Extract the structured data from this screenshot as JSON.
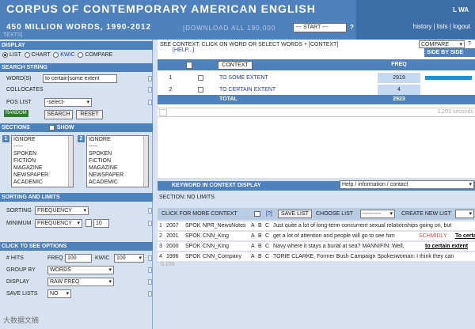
{
  "header": {
    "title": "CORPUS OF CONTEMPORARY AMERICAN ENGLISH",
    "subtitle": "450 MILLION WORDS, 1990-2012",
    "download": "[DOWNLOAD ALL 190,000",
    "texts": "TEXTS]",
    "start_select": "--- START ---",
    "help_mark": "?",
    "user": "L WA",
    "links": [
      "history",
      "lists",
      "logout"
    ]
  },
  "left": {
    "display_head": "DISPLAY",
    "display_opts": [
      "LIST",
      "CHART",
      "KWIC",
      "COMPARE"
    ],
    "search_head": "SEARCH STRING",
    "words_label": "WORD(S)",
    "words_value": "to certain|some extent",
    "collocates_label": "COLLOCATES",
    "poslist_label": "POS LIST",
    "poslist_value": "-select-",
    "random_label": "RANDOM",
    "search_btn": "SEARCH",
    "reset_btn": "RESET",
    "sections_head": "SECTIONS",
    "show_label": "SHOW",
    "section1_no": "1",
    "section2_no": "2",
    "sections1": [
      "IGNORE",
      "-----",
      "SPOKEN",
      "FICTION",
      "MAGAZINE",
      "NEWSPAPER",
      "ACADEMIC"
    ],
    "sections2": [
      "IGNORE",
      "-----",
      "SPOKEN",
      "FICTION",
      "MAGAZINE",
      "NEWSPAPER",
      "ACADEMIC"
    ],
    "sorting_head": "SORTING AND LIMITS",
    "sorting_label": "SORTING",
    "sorting_value": "FREQUENCY",
    "minimum_label": "MINIMUM",
    "minimum_value": "FREQUENCY",
    "minimum_num": "10",
    "options_head": "CLICK TO SEE OPTIONS",
    "hits_label": "# HITS",
    "freq_label": "FREQ",
    "freq_value": "100",
    "kwic_label": "KWIC",
    "kwic_value": "100",
    "groupby_label": "GROUP BY",
    "groupby_value": "WORDS",
    "display_label": "DISPLAY",
    "display_value": "RAW FREQ",
    "savelists_label": "SAVE LISTS",
    "savelists_value": "NO"
  },
  "results": {
    "instruction": "SEE CONTEXT: CLICK ON WORD OR SELECT WORDS + [CONTEXT]",
    "help_link": "[HELP...]",
    "compare_select": "COMPARE",
    "compare_q": "?",
    "side_by_side": "SIDE BY SIDE",
    "context_header": "CONTEXT",
    "freq_header": "FREQ",
    "rows": [
      {
        "num": "1",
        "text": "TO SOME EXTENT",
        "freq": "2919",
        "share": 0.99
      },
      {
        "num": "2",
        "text": "TO CERTAIN EXTENT",
        "freq": "4",
        "share": 0.0
      }
    ],
    "total_label": "TOTAL",
    "total_freq": "2923",
    "seconds": "1.203 seconds"
  },
  "kwic": {
    "header": "KEYWORD IN CONTEXT DISPLAY",
    "help_select": "Help / information / contact",
    "section_line": "SECTION: NO LIMITS",
    "more_context": "CLICK FOR MORE CONTEXT",
    "q_link": "[?]",
    "save_list": "SAVE LIST",
    "choose_list": "CHOOSE LIST",
    "choose_value": "----------",
    "create_new": "CREATE NEW LIST",
    "rows": [
      {
        "n": "1",
        "year": "2007",
        "genre": "SPOK",
        "source": "NPR_NewsNotes",
        "a": "A",
        "b": "B",
        "c": "C",
        "pre": "Just quite a lot of long-term concurrent sexual relationships going on, but",
        "name": "",
        "hit": ""
      },
      {
        "n": "2",
        "year": "2001",
        "genre": "SPOK",
        "source": "CNN_King",
        "a": "A",
        "b": "B",
        "c": "C",
        "pre": "get a lot of attention and people will go to see him",
        "name": "SCHMIDLY",
        "hit": "To certa"
      },
      {
        "n": "3",
        "year": "2000",
        "genre": "SPOK",
        "source": "CNN_King",
        "a": "A",
        "b": "B",
        "c": "C",
        "pre": "Navy where it stays a burial at sea? MANNIFIN: Well,",
        "name": "",
        "hit": "to certain extent"
      },
      {
        "n": "4",
        "year": "1996",
        "genre": "SPOK",
        "source": "CNN_Company",
        "a": "A",
        "b": "B",
        "c": "C",
        "pre": "TORIE CLARKE, Former Bush Campaign Spokeswoman: I think they can",
        "name": "",
        "hit": ""
      }
    ],
    "time": "0.156"
  },
  "watermark": "大数据文摘"
}
